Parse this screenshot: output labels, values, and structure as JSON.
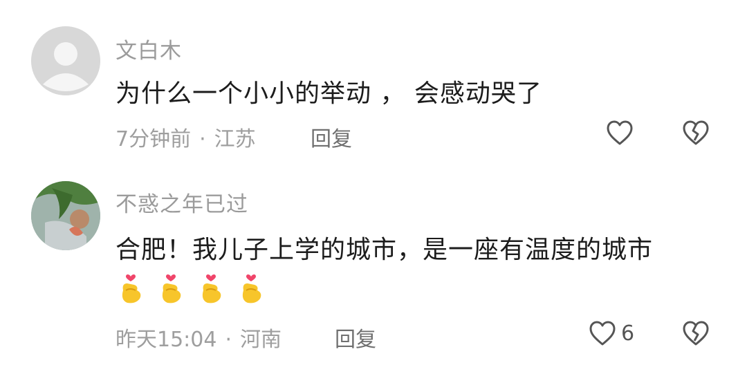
{
  "comments": [
    {
      "username": "文白木",
      "text": "为什么一个小小的举动 ， 会感动哭了",
      "time": "7分钟前",
      "location": "江苏",
      "reply_label": "回复",
      "like_count": "",
      "avatar_icon": "default-user-avatar"
    },
    {
      "username": "不惑之年已过",
      "text": "合肥！我儿子上学的城市，是一座有温度的城市",
      "emoji_name": "finger-heart-emoji",
      "emoji_count": 4,
      "time": "昨天15:04",
      "location": "河南",
      "reply_label": "回复",
      "like_count": "6",
      "avatar_icon": "photo-avatar"
    }
  ],
  "separator": "·",
  "icons": {
    "like": "heart-outline-icon",
    "dislike": "broken-heart-icon"
  }
}
